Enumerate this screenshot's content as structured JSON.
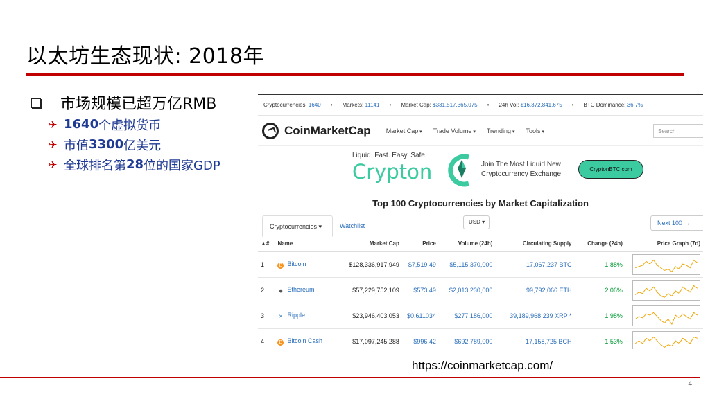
{
  "slide": {
    "title": "以太坊生态现状: 2018年",
    "main_bullet": "市场规模已超万亿RMB",
    "sub_bullets": [
      {
        "strong": "1640",
        "rest": "个虚拟货币"
      },
      {
        "prefix": "市值",
        "strong": "3300",
        "rest": "亿美元"
      },
      {
        "prefix": "全球排名第",
        "strong": "28",
        "rest": "位的国家GDP"
      }
    ],
    "url": "https://coinmarketcap.com/",
    "page_number": "4"
  },
  "site": {
    "stats": {
      "cryptocurrencies_label": "Cryptocurrencies:",
      "cryptocurrencies_value": "1640",
      "markets_label": "Markets:",
      "markets_value": "11141",
      "market_cap_label": "Market Cap:",
      "market_cap_value": "$331,517,365,075",
      "vol_label": "24h Vol:",
      "vol_value": "$16,372,841,675",
      "dominance_label": "BTC Dominance:",
      "dominance_value": "36.7%"
    },
    "logo_text": "CoinMarketCap",
    "nav": [
      "Market Cap",
      "Trade Volume",
      "Trending",
      "Tools"
    ],
    "search_placeholder": "Search",
    "ad": {
      "tagline": "Liquid. Fast. Easy. Safe.",
      "brand": "Crypton",
      "headline_line1": "Join The Most Liquid New",
      "headline_line2": "Cryptocurrency Exchange",
      "cta": "CryptonBTC.com"
    },
    "heading": "Top 100 Cryptocurrencies by Market Capitalization",
    "tabs": {
      "active": "Cryptocurrencies ▾",
      "watchlist": "Watchlist"
    },
    "currency": "USD ▾",
    "next_button": "Next 100 →",
    "table": {
      "headers": [
        "▲#",
        "Name",
        "Market Cap",
        "Price",
        "Volume (24h)",
        "Circulating Supply",
        "Change (24h)",
        "Price Graph (7d)"
      ],
      "rows": [
        {
          "rank": "1",
          "name": "Bitcoin",
          "icon_color": "#f7931a",
          "icon_glyph": "B",
          "market_cap": "$128,336,917,949",
          "price": "$7,519.49",
          "volume": "$5,115,370,000",
          "supply": "17,067,237 BTC",
          "change": "1.88%",
          "spark": [
            20,
            18,
            16,
            10,
            14,
            8,
            16,
            20,
            24,
            22,
            26,
            18,
            22,
            14,
            16,
            20,
            8,
            12
          ]
        },
        {
          "rank": "2",
          "name": "Ethereum",
          "icon_color": "#555555",
          "icon_glyph": "◆",
          "market_cap": "$57,229,752,109",
          "price": "$573.49",
          "volume": "$2,013,230,000",
          "supply": "99,792,066 ETH",
          "change": "2.06%",
          "spark": [
            22,
            18,
            20,
            12,
            16,
            10,
            18,
            24,
            26,
            20,
            24,
            16,
            20,
            10,
            14,
            18,
            8,
            12
          ]
        },
        {
          "rank": "3",
          "name": "Ripple",
          "icon_color": "#2a7ab8",
          "icon_glyph": "✕",
          "market_cap": "$23,946,403,053",
          "price": "$0.611034",
          "volume": "$277,186,000",
          "supply": "39,189,968,239 XRP *",
          "change": "1.98%",
          "spark": [
            20,
            16,
            18,
            12,
            14,
            10,
            16,
            22,
            26,
            20,
            28,
            14,
            18,
            12,
            16,
            20,
            10,
            14
          ]
        },
        {
          "rank": "4",
          "name": "Bitcoin Cash",
          "icon_color": "#f7931a",
          "icon_glyph": "B",
          "market_cap": "$17,097,245,288",
          "price": "$996.42",
          "volume": "$692,789,000",
          "supply": "17,158,725 BCH",
          "change": "1.53%",
          "spark": [
            18,
            14,
            18,
            10,
            14,
            8,
            14,
            20,
            24,
            20,
            22,
            14,
            18,
            10,
            14,
            18,
            8,
            10
          ]
        }
      ]
    }
  },
  "colors": {
    "accent_red": "#c00000",
    "bullet_blue": "#1f3a93",
    "link_blue": "#2a6ebb",
    "positive_green": "#009933",
    "spark_gold": "#f0a500"
  }
}
